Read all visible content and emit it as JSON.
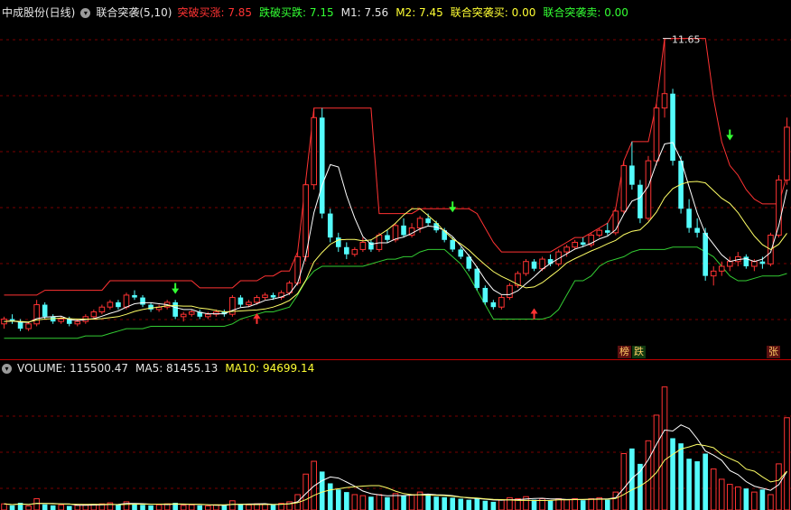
{
  "main_panel": {
    "title": "中成股份(日线)",
    "indicator_name": "联合突袭(5,10)",
    "labels": [
      {
        "text": "突破买涨: 7.85",
        "color": "#ff3333"
      },
      {
        "text": "跌破买跌: 7.15",
        "color": "#33ff33"
      },
      {
        "text": "M1: 7.56",
        "color": "#e6e6e6"
      },
      {
        "text": "M2: 7.45",
        "color": "#ffff33"
      },
      {
        "text": "联合突袭买: 0.00",
        "color": "#ffff33"
      },
      {
        "text": "联合突袭卖: 0.00",
        "color": "#33ff33"
      }
    ],
    "peak_label": "11.65",
    "badges": [
      {
        "text": "榜",
        "color": "#ffcc66",
        "bg": "#5a1010"
      },
      {
        "text": "跌",
        "color": "#ffcc66",
        "bg": "#103a10"
      },
      {
        "text": "张",
        "color": "#ffcc66",
        "bg": "#5a1010"
      }
    ]
  },
  "volume_panel": {
    "labels": [
      {
        "text": "VOLUME: 115500.47",
        "color": "#e6e6e6"
      },
      {
        "text": "MA5: 81455.13",
        "color": "#e6e6e6"
      },
      {
        "text": "MA10: 94699.14",
        "color": "#ffff33"
      }
    ]
  },
  "colors": {
    "up": "#ff3333",
    "down": "#54fcfc",
    "resistance": "#ff3333",
    "support": "#33cc33",
    "ma_short": "#ffffff",
    "ma_long": "#ffff66",
    "grid": "#7a0000"
  },
  "chart_data": {
    "type": "candlestick",
    "candles": [
      [
        5.7,
        5.85,
        5.6,
        5.8
      ],
      [
        5.8,
        5.9,
        5.7,
        5.75
      ],
      [
        5.75,
        5.8,
        5.55,
        5.6
      ],
      [
        5.6,
        5.75,
        5.55,
        5.7
      ],
      [
        5.7,
        6.2,
        5.65,
        6.1
      ],
      [
        6.1,
        6.15,
        5.8,
        5.85
      ],
      [
        5.85,
        5.9,
        5.7,
        5.75
      ],
      [
        5.75,
        5.85,
        5.7,
        5.8
      ],
      [
        5.8,
        5.85,
        5.65,
        5.7
      ],
      [
        5.7,
        5.8,
        5.65,
        5.75
      ],
      [
        5.75,
        5.9,
        5.7,
        5.85
      ],
      [
        5.85,
        6.0,
        5.8,
        5.95
      ],
      [
        5.95,
        6.1,
        5.9,
        6.05
      ],
      [
        6.05,
        6.2,
        6.0,
        6.15
      ],
      [
        6.15,
        6.2,
        6.0,
        6.05
      ],
      [
        6.05,
        6.35,
        6.0,
        6.3
      ],
      [
        6.3,
        6.4,
        6.2,
        6.25
      ],
      [
        6.25,
        6.3,
        6.05,
        6.1
      ],
      [
        6.1,
        6.15,
        5.95,
        6.0
      ],
      [
        6.0,
        6.1,
        5.95,
        6.05
      ],
      [
        6.05,
        6.2,
        6.0,
        6.15
      ],
      [
        6.15,
        6.2,
        5.8,
        5.85
      ],
      [
        5.85,
        5.95,
        5.75,
        5.9
      ],
      [
        5.9,
        6.0,
        5.85,
        5.95
      ],
      [
        5.95,
        6.0,
        5.8,
        5.85
      ],
      [
        5.85,
        5.95,
        5.8,
        5.9
      ],
      [
        5.9,
        6.0,
        5.85,
        5.95
      ],
      [
        5.95,
        6.0,
        5.85,
        5.9
      ],
      [
        5.9,
        6.3,
        5.85,
        6.25
      ],
      [
        6.25,
        6.3,
        6.05,
        6.1
      ],
      [
        6.1,
        6.2,
        6.05,
        6.15
      ],
      [
        6.15,
        6.3,
        6.1,
        6.25
      ],
      [
        6.25,
        6.35,
        6.2,
        6.3
      ],
      [
        6.3,
        6.35,
        6.2,
        6.25
      ],
      [
        6.25,
        6.4,
        6.2,
        6.35
      ],
      [
        6.35,
        6.6,
        6.3,
        6.55
      ],
      [
        6.55,
        7.2,
        6.5,
        7.1
      ],
      [
        7.1,
        8.7,
        7.0,
        8.6
      ],
      [
        8.6,
        10.2,
        8.5,
        10.0
      ],
      [
        10.0,
        10.2,
        7.9,
        8.0
      ],
      [
        8.0,
        8.1,
        7.4,
        7.5
      ],
      [
        7.5,
        7.6,
        7.2,
        7.3
      ],
      [
        7.3,
        7.4,
        7.05,
        7.15
      ],
      [
        7.15,
        7.3,
        7.1,
        7.25
      ],
      [
        7.25,
        7.5,
        7.2,
        7.4
      ],
      [
        7.4,
        7.45,
        7.2,
        7.25
      ],
      [
        7.25,
        7.6,
        7.2,
        7.55
      ],
      [
        7.55,
        7.65,
        7.4,
        7.45
      ],
      [
        7.45,
        7.8,
        7.4,
        7.75
      ],
      [
        7.75,
        7.9,
        7.5,
        7.55
      ],
      [
        7.55,
        7.8,
        7.5,
        7.7
      ],
      [
        7.7,
        7.95,
        7.6,
        7.9
      ],
      [
        7.9,
        8.0,
        7.75,
        7.8
      ],
      [
        7.8,
        7.85,
        7.6,
        7.65
      ],
      [
        7.65,
        7.7,
        7.4,
        7.45
      ],
      [
        7.45,
        7.5,
        7.2,
        7.25
      ],
      [
        7.25,
        7.3,
        7.05,
        7.1
      ],
      [
        7.1,
        7.15,
        6.8,
        6.85
      ],
      [
        6.85,
        6.9,
        6.4,
        6.45
      ],
      [
        6.45,
        6.5,
        6.1,
        6.15
      ],
      [
        6.15,
        6.2,
        6.0,
        6.05
      ],
      [
        6.05,
        6.3,
        6.0,
        6.25
      ],
      [
        6.25,
        6.55,
        6.2,
        6.5
      ],
      [
        6.5,
        6.8,
        6.45,
        6.75
      ],
      [
        6.75,
        7.05,
        6.7,
        7.0
      ],
      [
        7.0,
        7.05,
        6.8,
        6.85
      ],
      [
        6.85,
        7.1,
        6.8,
        7.05
      ],
      [
        7.05,
        7.15,
        6.9,
        6.95
      ],
      [
        6.95,
        7.25,
        6.9,
        7.2
      ],
      [
        7.2,
        7.35,
        7.1,
        7.3
      ],
      [
        7.3,
        7.45,
        7.25,
        7.4
      ],
      [
        7.4,
        7.5,
        7.3,
        7.35
      ],
      [
        7.35,
        7.6,
        7.3,
        7.55
      ],
      [
        7.55,
        7.7,
        7.5,
        7.65
      ],
      [
        7.65,
        7.8,
        7.55,
        7.6
      ],
      [
        7.6,
        8.1,
        7.55,
        8.05
      ],
      [
        8.05,
        9.1,
        8.0,
        9.0
      ],
      [
        9.0,
        9.5,
        8.5,
        8.6
      ],
      [
        8.6,
        8.7,
        7.8,
        7.9
      ],
      [
        7.9,
        9.2,
        7.85,
        9.1
      ],
      [
        9.1,
        10.3,
        9.0,
        10.2
      ],
      [
        10.2,
        11.65,
        10.0,
        10.5
      ],
      [
        10.5,
        10.6,
        9.0,
        9.1
      ],
      [
        9.1,
        9.2,
        8.0,
        8.1
      ],
      [
        8.1,
        8.3,
        7.6,
        7.7
      ],
      [
        7.7,
        7.9,
        7.5,
        7.6
      ],
      [
        7.6,
        7.7,
        6.6,
        6.7
      ],
      [
        6.7,
        6.9,
        6.5,
        6.8
      ],
      [
        6.8,
        7.0,
        6.7,
        6.9
      ],
      [
        6.9,
        7.1,
        6.8,
        7.0
      ],
      [
        7.0,
        7.2,
        6.9,
        7.1
      ],
      [
        7.1,
        7.15,
        6.85,
        6.9
      ],
      [
        6.9,
        7.05,
        6.8,
        7.0
      ],
      [
        7.0,
        7.1,
        6.85,
        6.95
      ],
      [
        6.95,
        7.6,
        6.9,
        7.55
      ],
      [
        7.55,
        8.8,
        7.5,
        8.7
      ],
      [
        8.7,
        10.0,
        8.6,
        9.8
      ]
    ],
    "ma_short": [
      5.75,
      5.76,
      5.74,
      5.73,
      5.81,
      5.84,
      5.85,
      5.86,
      5.79,
      5.77,
      5.79,
      5.81,
      5.86,
      5.92,
      5.97,
      6.05,
      6.12,
      6.14,
      6.14,
      6.12,
      6.1,
      6.04,
      6.0,
      6.0,
      5.94,
      5.91,
      5.91,
      5.91,
      5.98,
      6.04,
      6.06,
      6.12,
      6.19,
      6.22,
      6.26,
      6.33,
      6.55,
      7.12,
      8.02,
      8.59,
      9.02,
      8.97,
      8.38,
      7.91,
      7.52,
      7.36,
      7.39,
      7.39,
      7.47,
      7.51,
      7.59,
      7.68,
      7.74,
      7.72,
      7.65,
      7.52,
      7.33,
      7.12,
      6.88,
      6.62,
      6.41,
      6.31,
      6.31,
      6.39,
      6.54,
      6.68,
      6.84,
      6.96,
      7.06,
      7.16,
      7.26,
      7.31,
      7.38,
      7.47,
      7.53,
      7.66,
      7.99,
      8.26,
      8.33,
      8.57,
      9.05,
      9.45,
      9.48,
      9.12,
      8.56,
      8.01,
      7.58,
      7.36,
      7.14,
      7.0,
      7.04,
      7.06,
      7.0,
      7.05,
      7.19,
      7.75,
      8.5
    ],
    "ma_long": [
      5.75,
      5.76,
      5.75,
      5.74,
      5.78,
      5.8,
      5.81,
      5.82,
      5.81,
      5.8,
      5.8,
      5.8,
      5.81,
      5.83,
      5.85,
      5.9,
      5.96,
      6.0,
      6.03,
      6.05,
      6.08,
      6.08,
      6.07,
      6.07,
      6.03,
      6.01,
      5.98,
      5.95,
      5.96,
      5.97,
      5.98,
      5.99,
      6.01,
      6.05,
      6.11,
      6.19,
      6.33,
      6.61,
      6.99,
      7.19,
      7.36,
      7.45,
      7.46,
      7.46,
      7.43,
      7.45,
      7.55,
      7.66,
      7.8,
      7.97,
      8.1,
      8.1,
      7.96,
      7.81,
      7.63,
      7.47,
      7.37,
      7.24,
      7.08,
      6.93,
      6.79,
      6.69,
      6.61,
      6.52,
      6.45,
      6.47,
      6.56,
      6.69,
      6.82,
      6.97,
      7.06,
      7.14,
      7.22,
      7.29,
      7.37,
      7.44,
      7.56,
      7.63,
      7.66,
      7.82,
      8.03,
      8.33,
      8.52,
      8.61,
      8.66,
      8.67,
      8.64,
      8.48,
      8.32,
      8.21,
      8.02,
      7.77,
      7.53,
      7.35,
      7.25,
      7.36,
      7.59
    ],
    "resistance": [
      6.3,
      6.3,
      6.3,
      6.3,
      6.3,
      6.4,
      6.4,
      6.4,
      6.4,
      6.4,
      6.4,
      6.4,
      6.4,
      6.6,
      6.6,
      6.6,
      6.6,
      6.6,
      6.6,
      6.6,
      6.6,
      6.6,
      6.6,
      6.6,
      6.45,
      6.45,
      6.45,
      6.45,
      6.45,
      6.6,
      6.6,
      6.6,
      6.7,
      6.7,
      6.8,
      6.8,
      7.2,
      8.7,
      10.2,
      10.2,
      10.2,
      10.2,
      10.2,
      10.2,
      10.2,
      10.2,
      8.0,
      8.0,
      8.0,
      8.0,
      8.0,
      8.1,
      8.1,
      8.1,
      8.1,
      8.1,
      8.1,
      8.1,
      8.0,
      7.7,
      7.4,
      7.2,
      7.2,
      7.2,
      7.2,
      7.2,
      7.2,
      7.2,
      7.3,
      7.4,
      7.5,
      7.5,
      7.6,
      7.7,
      7.8,
      8.1,
      9.1,
      9.5,
      9.5,
      9.5,
      10.3,
      11.65,
      11.65,
      11.65,
      11.65,
      11.65,
      11.65,
      10.4,
      9.5,
      9.0,
      8.8,
      8.5,
      8.3,
      8.2,
      8.2,
      8.2,
      8.8
    ],
    "support": [
      5.4,
      5.4,
      5.4,
      5.4,
      5.4,
      5.4,
      5.4,
      5.4,
      5.4,
      5.4,
      5.45,
      5.45,
      5.45,
      5.5,
      5.55,
      5.6,
      5.6,
      5.6,
      5.65,
      5.65,
      5.65,
      5.65,
      5.65,
      5.65,
      5.65,
      5.65,
      5.65,
      5.65,
      5.7,
      5.8,
      5.85,
      5.9,
      5.95,
      5.95,
      6.0,
      6.05,
      6.3,
      6.6,
      6.8,
      6.9,
      6.9,
      6.9,
      6.9,
      6.9,
      6.9,
      6.95,
      7.0,
      7.05,
      7.05,
      7.1,
      7.1,
      7.2,
      7.25,
      7.25,
      7.25,
      7.1,
      6.95,
      6.7,
      6.4,
      6.1,
      5.8,
      5.8,
      5.8,
      5.8,
      5.8,
      5.8,
      5.8,
      5.85,
      6.0,
      6.3,
      6.6,
      6.6,
      6.7,
      6.9,
      7.0,
      7.05,
      7.1,
      7.2,
      7.25,
      7.25,
      7.25,
      7.25,
      7.3,
      7.3,
      7.3,
      7.3,
      7.2,
      7.1,
      6.9,
      6.7,
      6.6,
      6.6,
      6.65,
      6.7,
      6.7,
      6.7,
      6.75
    ],
    "volume": [
      12000,
      9000,
      14000,
      8000,
      22000,
      11000,
      9000,
      10000,
      8000,
      9000,
      10000,
      11000,
      12000,
      14000,
      10000,
      16000,
      12000,
      10000,
      9000,
      10000,
      12000,
      14000,
      9000,
      10000,
      9000,
      8000,
      10000,
      9000,
      18000,
      11000,
      10000,
      12000,
      11000,
      10000,
      13000,
      16000,
      30000,
      70000,
      95000,
      75000,
      52000,
      40000,
      35000,
      30000,
      28000,
      26000,
      30000,
      25000,
      32000,
      28000,
      30000,
      35000,
      30000,
      26000,
      25000,
      24000,
      22000,
      20000,
      22000,
      18000,
      16000,
      20000,
      24000,
      22000,
      26000,
      20000,
      22000,
      18000,
      22000,
      20000,
      22000,
      19000,
      22000,
      24000,
      20000,
      35000,
      110000,
      120000,
      90000,
      135000,
      185000,
      240000,
      140000,
      130000,
      100000,
      95000,
      110000,
      80000,
      60000,
      50000,
      45000,
      42000,
      35000,
      40000,
      30000,
      90000,
      180000
    ],
    "vol_ma5": [
      12000,
      10500,
      11667,
      10750,
      13000,
      12800,
      12800,
      12000,
      12000,
      9400,
      9200,
      9600,
      10000,
      10800,
      11000,
      12600,
      12800,
      12400,
      11400,
      11400,
      10600,
      11400,
      11000,
      11000,
      10800,
      10000,
      9200,
      9200,
      11000,
      11200,
      11600,
      12000,
      12400,
      10800,
      11200,
      12400,
      16000,
      31800,
      46800,
      57200,
      64400,
      62400,
      54600,
      46400,
      37000,
      31800,
      29600,
      27800,
      28200,
      28200,
      29000,
      30000,
      31000,
      29800,
      29200,
      28000,
      25400,
      23400,
      22600,
      21200,
      19600,
      19200,
      20000,
      20000,
      21600,
      22400,
      22800,
      21600,
      21600,
      20400,
      20800,
      20200,
      21200,
      21400,
      21400,
      24000,
      42200,
      61800,
      75000,
      98000,
      128000,
      156000,
      154000,
      166000,
      159000,
      139000,
      115000,
      107000,
      97000,
      77000,
      69000,
      55400,
      46400,
      42400,
      38400,
      49400,
      75000
    ],
    "vol_ma10": [
      12000,
      10500,
      11667,
      10750,
      12800,
      12667,
      12143,
      11875,
      11444,
      11200,
      11000,
      11200,
      11000,
      11200,
      10400,
      10900,
      11200,
      11200,
      11300,
      11400,
      11600,
      12000,
      11700,
      11300,
      11200,
      10400,
      10200,
      10100,
      11000,
      11100,
      10800,
      10600,
      10800,
      10800,
      11200,
      12000,
      14200,
      20000,
      28600,
      35000,
      39000,
      41400,
      43800,
      45200,
      46600,
      47600,
      47600,
      43100,
      36800,
      32100,
      29900,
      29400,
      28900,
      28500,
      28200,
      27000,
      25200,
      24200,
      23200,
      21800,
      20600,
      20200,
      19600,
      18700,
      18800,
      18400,
      18400,
      18700,
      19700,
      19800,
      20200,
      20600,
      20600,
      20900,
      21200,
      22400,
      30200,
      39400,
      46400,
      57400,
      73000,
      97400,
      108400,
      119000,
      123000,
      128000,
      125500,
      121500,
      108500,
      100500,
      93500,
      79700,
      75700,
      64700,
      54700,
      58000,
      75700
    ]
  }
}
